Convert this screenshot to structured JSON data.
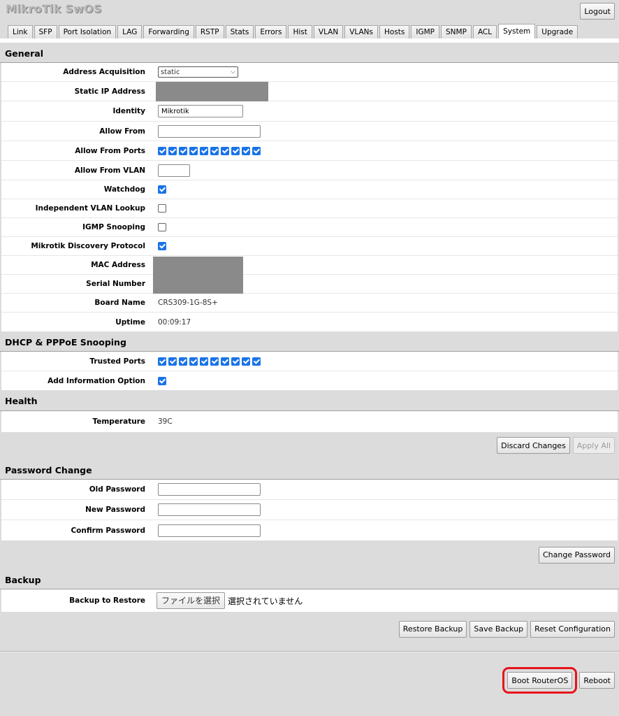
{
  "app": {
    "title": "MikroTik SwOS",
    "logout_label": "Logout"
  },
  "tabs": [
    {
      "label": "Link"
    },
    {
      "label": "SFP"
    },
    {
      "label": "Port Isolation"
    },
    {
      "label": "LAG"
    },
    {
      "label": "Forwarding"
    },
    {
      "label": "RSTP"
    },
    {
      "label": "Stats"
    },
    {
      "label": "Errors"
    },
    {
      "label": "Hist"
    },
    {
      "label": "VLAN"
    },
    {
      "label": "VLANs"
    },
    {
      "label": "Hosts"
    },
    {
      "label": "IGMP"
    },
    {
      "label": "SNMP"
    },
    {
      "label": "ACL"
    },
    {
      "label": "System",
      "active": true
    },
    {
      "label": "Upgrade"
    }
  ],
  "general": {
    "title": "General",
    "address_acquisition": {
      "label": "Address Acquisition",
      "value": "static"
    },
    "static_ip": {
      "label": "Static IP Address"
    },
    "identity": {
      "label": "Identity",
      "value": "Mikrotik"
    },
    "allow_from": {
      "label": "Allow From",
      "value": ""
    },
    "allow_from_ports": {
      "label": "Allow From Ports",
      "checked": [
        true,
        true,
        true,
        true,
        true,
        true,
        true,
        true,
        true,
        true
      ]
    },
    "allow_from_vlan": {
      "label": "Allow From VLAN",
      "value": ""
    },
    "watchdog": {
      "label": "Watchdog",
      "checked": true
    },
    "independent_vlan_lookup": {
      "label": "Independent VLAN Lookup",
      "checked": false
    },
    "igmp_snooping": {
      "label": "IGMP Snooping",
      "checked": false
    },
    "mikrotik_discovery": {
      "label": "Mikrotik Discovery Protocol",
      "checked": true
    },
    "mac_address": {
      "label": "MAC Address"
    },
    "serial_number": {
      "label": "Serial Number"
    },
    "board_name": {
      "label": "Board Name",
      "value": "CRS309-1G-8S+"
    },
    "uptime": {
      "label": "Uptime",
      "value": "00:09:17"
    }
  },
  "dhcp": {
    "title": "DHCP & PPPoE Snooping",
    "trusted_ports": {
      "label": "Trusted Ports",
      "checked": [
        true,
        true,
        true,
        true,
        true,
        true,
        true,
        true,
        true,
        true
      ]
    },
    "add_information_option": {
      "label": "Add Information Option",
      "checked": true
    }
  },
  "health": {
    "title": "Health",
    "temperature": {
      "label": "Temperature",
      "value": "39C"
    }
  },
  "actions": {
    "discard_label": "Discard Changes",
    "apply_label": "Apply All"
  },
  "password": {
    "title": "Password Change",
    "old_label": "Old Password",
    "new_label": "New Password",
    "confirm_label": "Confirm Password",
    "change_label": "Change Password"
  },
  "backup": {
    "title": "Backup",
    "restore_label": "Backup to Restore",
    "file_button_label": "ファイルを選択",
    "file_status": "選択されていません",
    "restore_button": "Restore Backup",
    "save_button": "Save Backup",
    "reset_button": "Reset Configuration"
  },
  "footer": {
    "boot_routeros_label": "Boot RouterOS",
    "reboot_label": "Reboot"
  }
}
